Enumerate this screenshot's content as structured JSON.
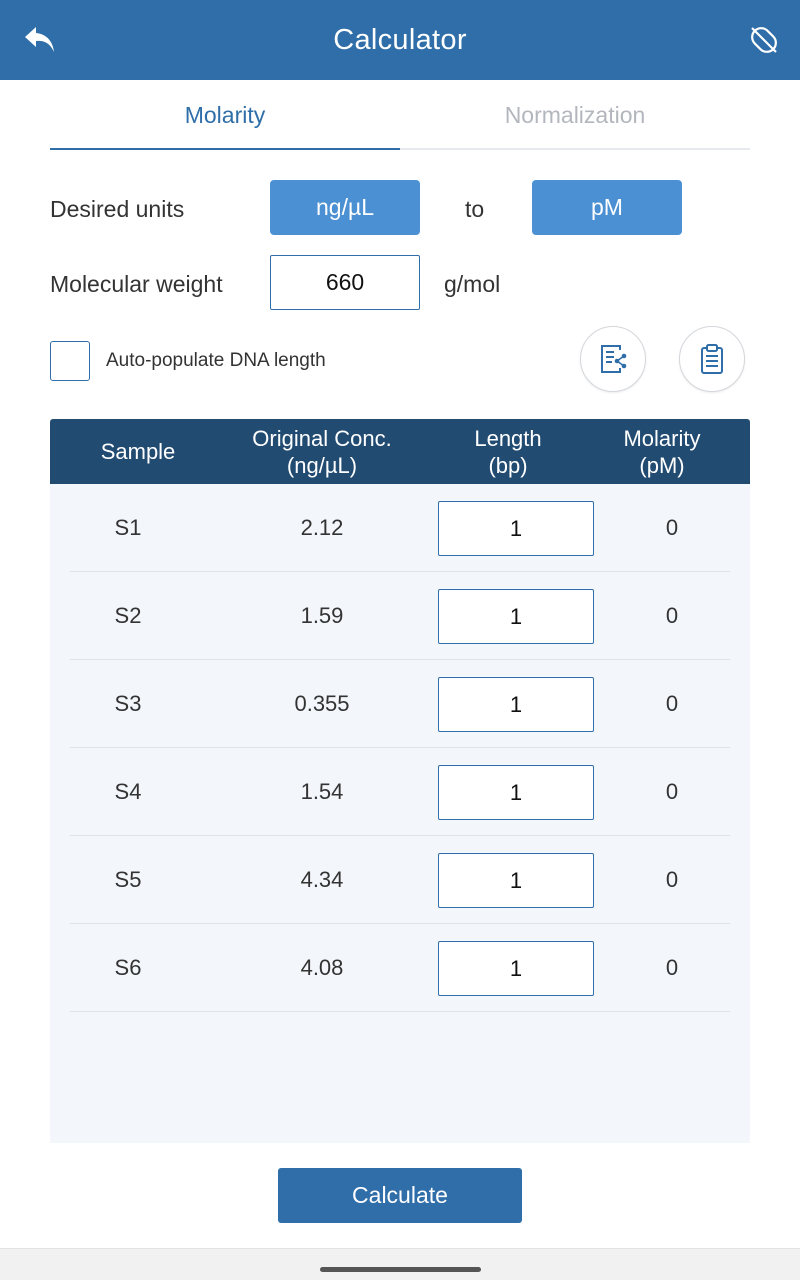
{
  "header": {
    "title": "Calculator",
    "back_icon": "undo-arrow-icon",
    "right_icon": "no-sample-icon"
  },
  "tabs": [
    {
      "label": "Molarity",
      "active": true
    },
    {
      "label": "Normalization",
      "active": false
    }
  ],
  "units": {
    "label": "Desired units",
    "from": "ng/µL",
    "to_label": "to",
    "to": "pM"
  },
  "molecular_weight": {
    "label": "Molecular weight",
    "value": "660",
    "unit": "g/mol"
  },
  "auto_populate": {
    "label": "Auto-populate DNA length",
    "checked": false
  },
  "actions": {
    "left_icon": "export-share-icon",
    "right_icon": "clipboard-icon"
  },
  "table": {
    "headers": [
      [
        "Sample"
      ],
      [
        "Original Conc.",
        "(ng/µL)"
      ],
      [
        "Length",
        "(bp)"
      ],
      [
        "Molarity",
        "(pM)"
      ]
    ],
    "rows": [
      {
        "sample": "S1",
        "conc": "2.12",
        "length": "1",
        "molarity": "0"
      },
      {
        "sample": "S2",
        "conc": "1.59",
        "length": "1",
        "molarity": "0"
      },
      {
        "sample": "S3",
        "conc": "0.355",
        "length": "1",
        "molarity": "0"
      },
      {
        "sample": "S4",
        "conc": "1.54",
        "length": "1",
        "molarity": "0"
      },
      {
        "sample": "S5",
        "conc": "4.34",
        "length": "1",
        "molarity": "0"
      },
      {
        "sample": "S6",
        "conc": "4.08",
        "length": "1",
        "molarity": "0"
      }
    ]
  },
  "calculate_label": "Calculate",
  "colors": {
    "primary": "#2f6ea8",
    "unit_button": "#4b90d3",
    "table_header": "#224b72",
    "table_bg": "#f3f7fb"
  }
}
